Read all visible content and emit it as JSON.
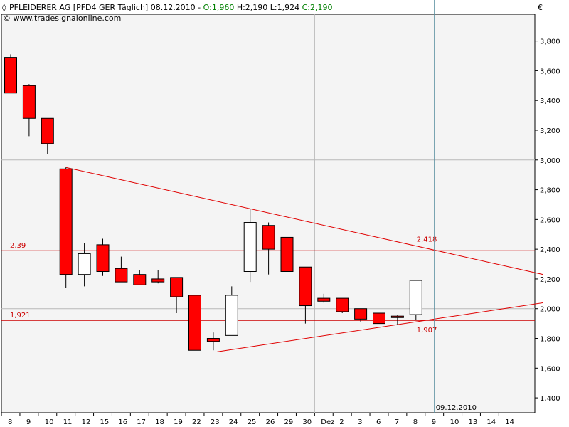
{
  "header": {
    "instrument": "PFLEIDERER AG [PFD4 GER  Täglich] 08.12.2010 - ",
    "open_label": "O:1,960",
    "hlc_label": " H:2,190 L:1,924 ",
    "close_label": "C:2,190",
    "copyright": "© www.tradesignalonline.com",
    "currency": "€"
  },
  "colors": {
    "up_fill": "#ffffff",
    "down_fill": "#ff0000",
    "candle_outline": "#000000",
    "trendline": "#e00000",
    "level_line": "#cc0000",
    "cursor_line": "#5a8fa0",
    "cursor_text": "#2d6f86",
    "open_text": "#008000",
    "close_text": "#008000",
    "plot_bg": "#f4f4f4",
    "grid": "#b8b8b8"
  },
  "chart_data": {
    "type": "candlestick",
    "title": "PFLEIDERER AG [PFD4 GER  Täglich]",
    "ylim": [
      1.3,
      3.98
    ],
    "y_ticks": [
      1.4,
      1.6,
      1.8,
      2.0,
      2.2,
      2.4,
      2.6,
      2.8,
      3.0,
      3.2,
      3.4,
      3.6,
      3.8
    ],
    "y_tick_labels": [
      "1,400",
      "1,600",
      "1,800",
      "2,000",
      "2,200",
      "2,400",
      "2,600",
      "2,800",
      "3,000",
      "3,200",
      "3,400",
      "3,600",
      "3,800"
    ],
    "y_grid_major": [
      2.0,
      3.0
    ],
    "x_labels": [
      "8",
      "9",
      "10",
      "11",
      "12",
      "15",
      "16",
      "17",
      "18",
      "19",
      "22",
      "23",
      "24",
      "25",
      "26",
      "29",
      "30",
      "Dez",
      "2",
      "3",
      "6",
      "7",
      "8",
      "9",
      "10",
      "13",
      "14",
      "14"
    ],
    "candles": [
      {
        "date": "8",
        "o": 3.69,
        "h": 3.71,
        "l": 3.45,
        "c": 3.45
      },
      {
        "date": "9",
        "o": 3.5,
        "h": 3.51,
        "l": 3.16,
        "c": 3.28
      },
      {
        "date": "10",
        "o": 3.28,
        "h": 3.28,
        "l": 3.04,
        "c": 3.11
      },
      {
        "date": "11",
        "o": 2.94,
        "h": 2.95,
        "l": 2.14,
        "c": 2.23
      },
      {
        "date": "12",
        "o": 2.23,
        "h": 2.44,
        "l": 2.15,
        "c": 2.37
      },
      {
        "date": "15",
        "o": 2.43,
        "h": 2.47,
        "l": 2.22,
        "c": 2.25
      },
      {
        "date": "16",
        "o": 2.27,
        "h": 2.35,
        "l": 2.18,
        "c": 2.18
      },
      {
        "date": "17",
        "o": 2.23,
        "h": 2.26,
        "l": 2.16,
        "c": 2.16
      },
      {
        "date": "18",
        "o": 2.2,
        "h": 2.26,
        "l": 2.17,
        "c": 2.18
      },
      {
        "date": "19",
        "o": 2.21,
        "h": 2.21,
        "l": 1.97,
        "c": 2.08
      },
      {
        "date": "22",
        "o": 2.09,
        "h": 2.09,
        "l": 1.72,
        "c": 1.72
      },
      {
        "date": "23",
        "o": 1.8,
        "h": 1.84,
        "l": 1.72,
        "c": 1.78
      },
      {
        "date": "24",
        "o": 1.82,
        "h": 2.15,
        "l": 1.82,
        "c": 2.09
      },
      {
        "date": "25",
        "o": 2.25,
        "h": 2.67,
        "l": 2.18,
        "c": 2.58
      },
      {
        "date": "26",
        "o": 2.56,
        "h": 2.58,
        "l": 2.23,
        "c": 2.4
      },
      {
        "date": "29",
        "o": 2.48,
        "h": 2.51,
        "l": 2.25,
        "c": 2.25
      },
      {
        "date": "30",
        "o": 2.28,
        "h": 2.28,
        "l": 1.9,
        "c": 2.02
      },
      {
        "date": "Dez",
        "o": 2.07,
        "h": 2.1,
        "l": 2.04,
        "c": 2.05
      },
      {
        "date": "2",
        "o": 2.07,
        "h": 2.07,
        "l": 1.97,
        "c": 1.98
      },
      {
        "date": "3",
        "o": 2.0,
        "h": 2.0,
        "l": 1.91,
        "c": 1.93
      },
      {
        "date": "6",
        "o": 1.97,
        "h": 1.97,
        "l": 1.9,
        "c": 1.9
      },
      {
        "date": "7",
        "o": 1.95,
        "h": 1.96,
        "l": 1.89,
        "c": 1.94
      },
      {
        "date": "8",
        "o": 1.96,
        "h": 2.19,
        "l": 1.924,
        "c": 2.19
      }
    ],
    "levels": [
      {
        "label": "2,39",
        "value": 2.39
      },
      {
        "label": "1,921",
        "value": 1.921
      }
    ],
    "trendlines": [
      {
        "name": "upper",
        "x1": 3,
        "y1": 2.95,
        "x2": 28.9,
        "y2": 2.23
      },
      {
        "name": "lower",
        "x1": 11.2,
        "y1": 1.71,
        "x2": 28.9,
        "y2": 2.04
      }
    ],
    "annotations": [
      {
        "text": "2,418",
        "x": 22.5,
        "y": 2.418
      },
      {
        "text": "1,907",
        "x": 22.5,
        "y": 1.907
      }
    ],
    "cursor": {
      "x": 23.0,
      "date_label": "09.12.2010"
    }
  }
}
